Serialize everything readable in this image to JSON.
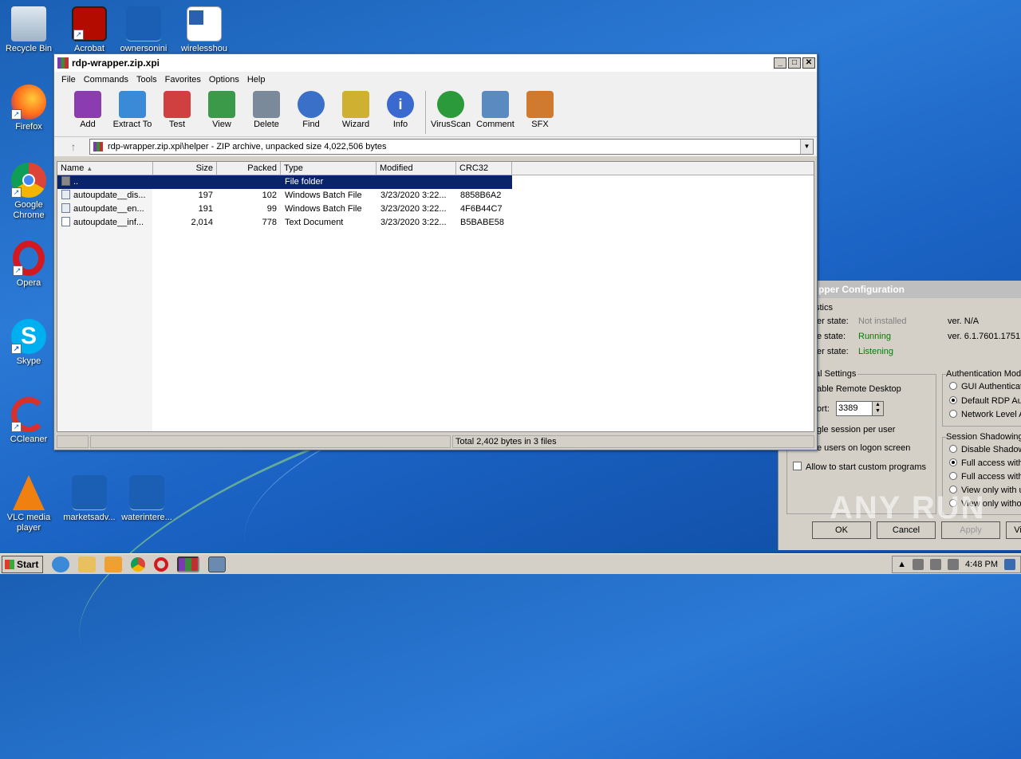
{
  "desktop": {
    "icons": [
      {
        "label": "Recycle Bin"
      },
      {
        "label": "Acrobat"
      },
      {
        "label": "ownersonini"
      },
      {
        "label": "wirelesshou"
      },
      {
        "label": "Firefox"
      },
      {
        "label": "Google Chrome"
      },
      {
        "label": "Opera"
      },
      {
        "label": "Skype"
      },
      {
        "label": "CCleaner"
      },
      {
        "label": "VLC media player"
      },
      {
        "label": "marketsadv..."
      },
      {
        "label": "waterintere..."
      }
    ]
  },
  "winrar": {
    "title": "rdp-wrapper.zip.xpi",
    "menu": [
      "File",
      "Commands",
      "Tools",
      "Favorites",
      "Options",
      "Help"
    ],
    "toolbar": [
      {
        "label": "Add",
        "icon": "add-archive-icon",
        "color": "#8a3cb0"
      },
      {
        "label": "Extract To",
        "icon": "folder-extract-icon",
        "color": "#3a8ad8"
      },
      {
        "label": "Test",
        "icon": "clipboard-test-icon",
        "color": "#d04040"
      },
      {
        "label": "View",
        "icon": "book-view-icon",
        "color": "#3a9a4a"
      },
      {
        "label": "Delete",
        "icon": "trash-icon",
        "color": "#7a8a9a"
      },
      {
        "label": "Find",
        "icon": "magnifier-icon",
        "color": "#3a70c8"
      },
      {
        "label": "Wizard",
        "icon": "magic-wand-icon",
        "color": "#d0b030"
      },
      {
        "label": "Info",
        "icon": "info-icon",
        "color": "#3a6ad0"
      },
      {
        "label": "VirusScan",
        "icon": "bug-scan-icon",
        "color": "#2a9a3a"
      },
      {
        "label": "Comment",
        "icon": "comment-icon",
        "color": "#5a8ac0"
      },
      {
        "label": "SFX",
        "icon": "sfx-books-icon",
        "color": "#d07a30"
      }
    ],
    "address": "rdp-wrapper.zip.xpi\\helper - ZIP archive, unpacked size 4,022,506 bytes",
    "columns": [
      "Name",
      "Size",
      "Packed",
      "Type",
      "Modified",
      "CRC32"
    ],
    "rows": [
      {
        "name": "..",
        "size": "",
        "packed": "",
        "type": "File folder",
        "modified": "",
        "crc": ""
      },
      {
        "name": "autoupdate__dis...",
        "size": "197",
        "packed": "102",
        "type": "Windows Batch File",
        "modified": "3/23/2020 3:22...",
        "crc": "8858B6A2"
      },
      {
        "name": "autoupdate__en...",
        "size": "191",
        "packed": "99",
        "type": "Windows Batch File",
        "modified": "3/23/2020 3:22...",
        "crc": "4F6B44C7"
      },
      {
        "name": "autoupdate__inf...",
        "size": "2,014",
        "packed": "778",
        "type": "Text Document",
        "modified": "3/23/2020 3:22...",
        "crc": "B5BABE58"
      }
    ],
    "status": "Total 2,402 bytes in 3 files"
  },
  "rdp": {
    "title": "pper Configuration",
    "diag_label": "stics",
    "wrapper_state_label": "er state:",
    "wrapper_state": "Not installed",
    "wrapper_ver": "ver. N/A",
    "service_state_label": "e state:",
    "service_state": "Running",
    "service_ver": "ver. 6.1.7601.1751",
    "listener_state_label": "er state:",
    "listener_state": "Listening",
    "general_settings": "al Settings",
    "enable_rdp": "able Remote Desktop",
    "port_label": "ort:",
    "port": "3389",
    "single_session": "gle session per user",
    "hide_users": "e users on logon screen",
    "allow_custom": "Allow to start custom programs",
    "auth_mode": "Authentication Mod",
    "auth_options": [
      "GUI Authenticat",
      "Default RDP Au",
      "Network Level A"
    ],
    "shadow_mode": "Session Shadowing",
    "shadow_options": [
      "Disable Shadow",
      "Full access with",
      "Full access with",
      "View only with u",
      "View only witho"
    ],
    "ok": "OK",
    "cancel": "Cancel",
    "apply": "Apply",
    "extra": "Vi"
  },
  "watermark": "ANY RUN",
  "taskbar": {
    "start": "Start",
    "clock": "4:48 PM"
  }
}
